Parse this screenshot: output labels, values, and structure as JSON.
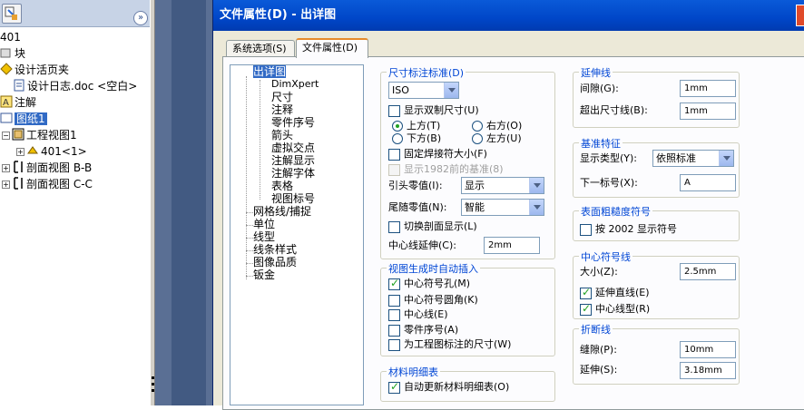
{
  "feature_tree": {
    "items": [
      {
        "label": "401"
      },
      {
        "label": "块"
      },
      {
        "label": "设计活页夹"
      },
      {
        "label": "设计日志.doc <空白>"
      },
      {
        "label": "注解"
      },
      {
        "label": "图纸1"
      },
      {
        "label": "工程视图1"
      },
      {
        "label": "401<1>"
      },
      {
        "label": "剖面视图 B-B"
      },
      {
        "label": "剖面视图 C-C"
      }
    ],
    "expand_icon": "»"
  },
  "dialog": {
    "title": "文件属性(D) - 出详图",
    "tabs": [
      {
        "label": "系统选项(S)"
      },
      {
        "label": "文件属性(D)"
      }
    ],
    "categories": [
      {
        "label": "出详图"
      },
      {
        "label": "DimXpert"
      },
      {
        "label": "尺寸"
      },
      {
        "label": "注释"
      },
      {
        "label": "零件序号"
      },
      {
        "label": "箭头"
      },
      {
        "label": "虚拟交点"
      },
      {
        "label": "注解显示"
      },
      {
        "label": "注解字体"
      },
      {
        "label": "表格"
      },
      {
        "label": "视图标号"
      },
      {
        "label": "网格线/捕捉"
      },
      {
        "label": "单位"
      },
      {
        "label": "线型"
      },
      {
        "label": "线条样式"
      },
      {
        "label": "图像品质"
      },
      {
        "label": "钣金"
      }
    ],
    "dim_standard": {
      "title": "尺寸标注标准(D)",
      "standard_value": "ISO",
      "dual_dim_label": "显示双制尺寸(U)",
      "top_label": "上方(T)",
      "right_label": "右方(O)",
      "bottom_label": "下方(B)",
      "left_label": "左方(U)",
      "fixed_weld_label": "固定焊接符大小(F)",
      "show_1982_label": "显示1982前的基准(8)",
      "leader_zero_label": "引头零值(I):",
      "leader_zero_value": "显示",
      "trailing_zero_label": "尾随零值(N):",
      "trailing_zero_value": "智能",
      "toggle_section_label": "切换剖面显示(L)",
      "centerline_ext_label": "中心线延伸(C):",
      "centerline_ext_value": "2mm"
    },
    "auto_insert": {
      "title": "视图生成时自动插入",
      "center_mark_holes": "中心符号孔(M)",
      "center_mark_fillets": "中心符号圆角(K)",
      "centerlines": "中心线(E)",
      "balloons": "零件序号(A)",
      "dims_marked": "为工程图标注的尺寸(W)"
    },
    "bom": {
      "title": "材料明细表",
      "auto_update": "自动更新材料明细表(O)"
    },
    "extension_lines": {
      "title": "延伸线",
      "gap_label": "间隙(G):",
      "gap_value": "1mm",
      "beyond_label": "超出尺寸线(B):",
      "beyond_value": "1mm"
    },
    "datum_feature": {
      "title": "基准特征",
      "type_label": "显示类型(Y):",
      "type_value": "依照标准",
      "next_label": "下一标号(X):",
      "next_value": "A"
    },
    "surface_finish": {
      "title": "表面粗糙度符号",
      "per_2002_label": "按 2002 显示符号"
    },
    "center_marks": {
      "title": "中心符号线",
      "size_label": "大小(Z):",
      "size_value": "2.5mm",
      "extended_label": "延伸直线(E)",
      "centerline_font_label": "中心线型(R)"
    },
    "break_lines": {
      "title": "折断线",
      "gap_label": "缝隙(P):",
      "gap_value": "10mm",
      "extension_label": "延伸(S):",
      "extension_value": "3.18mm"
    }
  },
  "colors": {
    "title_bar": "#0046c8",
    "group_title": "#0046d5",
    "selection": "#316ac5",
    "check": "#21a121"
  }
}
